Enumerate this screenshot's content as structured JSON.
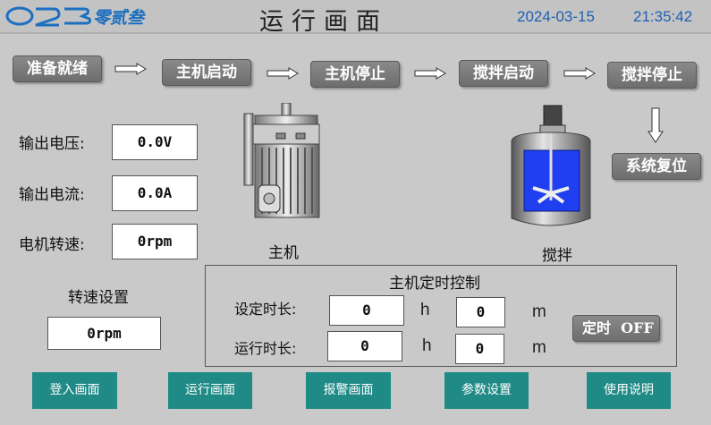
{
  "header": {
    "logo_text": "023零贰叁",
    "title": "运行画面",
    "date": "2024-03-15",
    "time": "21:35:42",
    "accent_color": "#1d5fb5"
  },
  "flow": {
    "step1": "准备就绪",
    "step2": "主机启动",
    "step3": "主机停止",
    "step4": "搅拌启动",
    "step5": "搅拌停止",
    "reset": "系统复位"
  },
  "readouts": {
    "voltage_label": "输出电压:",
    "voltage_value": "0.0V",
    "current_label": "输出电流:",
    "current_value": "0.0A",
    "speed_label": "电机转速:",
    "speed_value": "0rpm"
  },
  "machines": {
    "motor_label": "主机",
    "mixer_label": "搅拌"
  },
  "speed_setting": {
    "label": "转速设置",
    "value": "0rpm"
  },
  "timer": {
    "title": "主机定时控制",
    "set_label": "设定时长:",
    "set_h": "0",
    "set_m": "0",
    "run_label": "运行时长:",
    "run_h": "0",
    "run_m": "0",
    "unit_h": "h",
    "unit_m": "m",
    "toggle_label": "定时  OFF"
  },
  "nav": {
    "login": "登入画面",
    "run": "运行画面",
    "alarm": "报警画面",
    "params": "参数设置",
    "help": "使用说明",
    "color": "#1f8a86"
  }
}
